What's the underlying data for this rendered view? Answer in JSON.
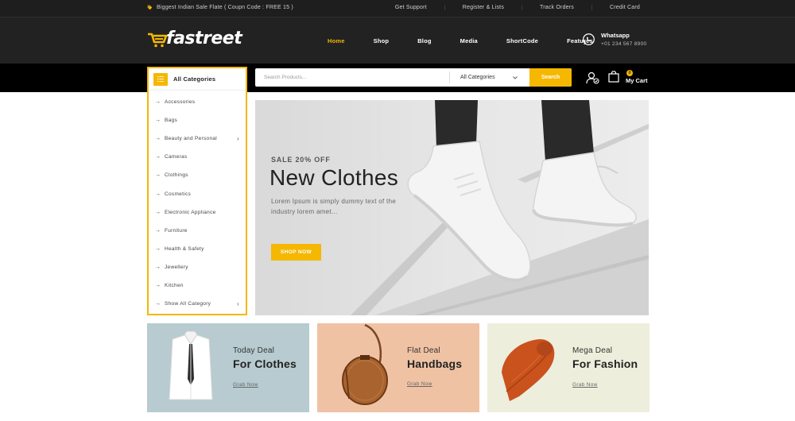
{
  "topbar": {
    "promo": "Biggest Indian Sale Flate ( Coupn Code : FREE 15 )",
    "links": [
      "Get Support",
      "Register & Lists",
      "Track Orders",
      "Credit Card"
    ]
  },
  "header": {
    "logo": "fastreet",
    "nav": [
      "Home",
      "Shop",
      "Blog",
      "Media",
      "ShortCode",
      "Features"
    ],
    "whatsapp_title": "Whatsapp",
    "whatsapp_phone": "+01 234 567 8900"
  },
  "categories": {
    "title": "All Categories",
    "items": [
      {
        "label": "Accessories"
      },
      {
        "label": "Bags"
      },
      {
        "label": "Beauty and Personal"
      },
      {
        "label": "Cameras"
      },
      {
        "label": "Clothings"
      },
      {
        "label": "Cosmetics"
      },
      {
        "label": "Electronic Appliance"
      },
      {
        "label": "Furniture"
      },
      {
        "label": "Health & Safety"
      },
      {
        "label": "Jewellery"
      },
      {
        "label": "Kitchen"
      },
      {
        "label": "Show All Category"
      }
    ]
  },
  "search": {
    "placeholder": "Search Products...",
    "category_value": "All Categories",
    "button": "Search"
  },
  "cart": {
    "count": "0",
    "label": "My Cart"
  },
  "hero": {
    "subtitle": "SALE 20% OFF",
    "title": "New Clothes",
    "description": "Lorem Ipsum is simply dummy text of the industry lorem amet...",
    "button": "SHOP NOW"
  },
  "promos": [
    {
      "sub": "Today Deal",
      "title": "For Clothes",
      "link": "Grab Now",
      "bg": "#b7cbd0"
    },
    {
      "sub": "Flat Deal",
      "title": "Handbags",
      "link": "Grab Now",
      "bg": "#efc2a4"
    },
    {
      "sub": "Mega Deal",
      "title": "For Fashion",
      "link": "Grab Now",
      "bg": "#eeeedd"
    }
  ],
  "colors": {
    "accent": "#f5b700",
    "header_bg": "#222222",
    "search_bar_bg": "#000000"
  }
}
